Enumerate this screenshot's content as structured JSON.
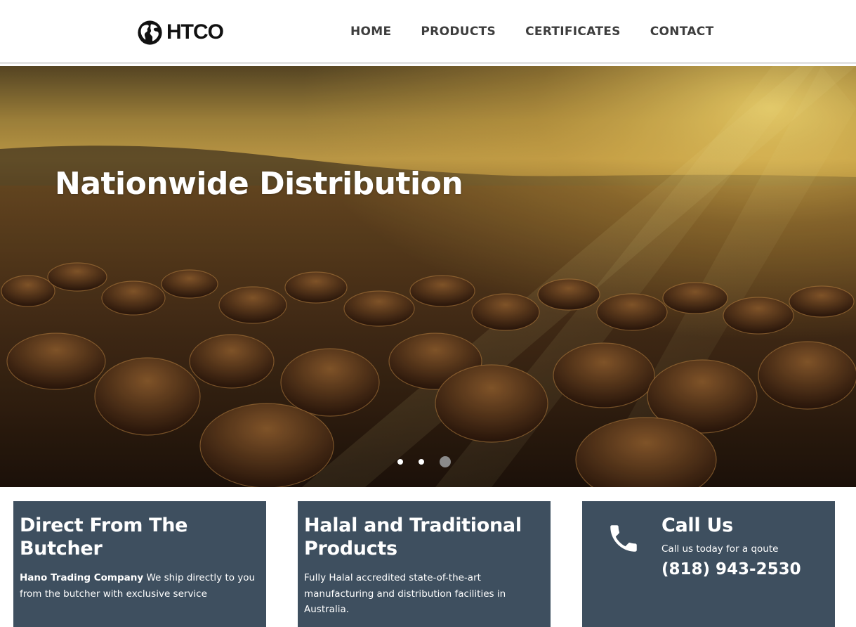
{
  "header": {
    "brand": "HTCO",
    "nav": [
      {
        "label": "HOME"
      },
      {
        "label": "PRODUCTS"
      },
      {
        "label": "CERTIFICATES"
      },
      {
        "label": "CONTACT"
      }
    ]
  },
  "hero": {
    "title": "Nationwide Distribution",
    "slides_total": 3,
    "active_slide": 3
  },
  "cards": {
    "butcher": {
      "title": "Direct From The Butcher",
      "company": "Hano Trading Company",
      "text": " We ship directly to you from the butcher with exclusive service"
    },
    "halal": {
      "title": "Halal and Traditional Products",
      "text": "Fully Halal accredited state-of-the-art manufacturing and distribution facilities in Australia."
    },
    "call": {
      "title": "Call Us",
      "subtitle": "Call us today for a qoute",
      "phone": "(818) 943-2530",
      "icon": "phone-icon"
    }
  },
  "colors": {
    "card_bg": "#3e4f5f",
    "nav_text": "#3d3d3d",
    "inactive_dot": "#ffffff",
    "active_dot": "#8a8a8a"
  }
}
